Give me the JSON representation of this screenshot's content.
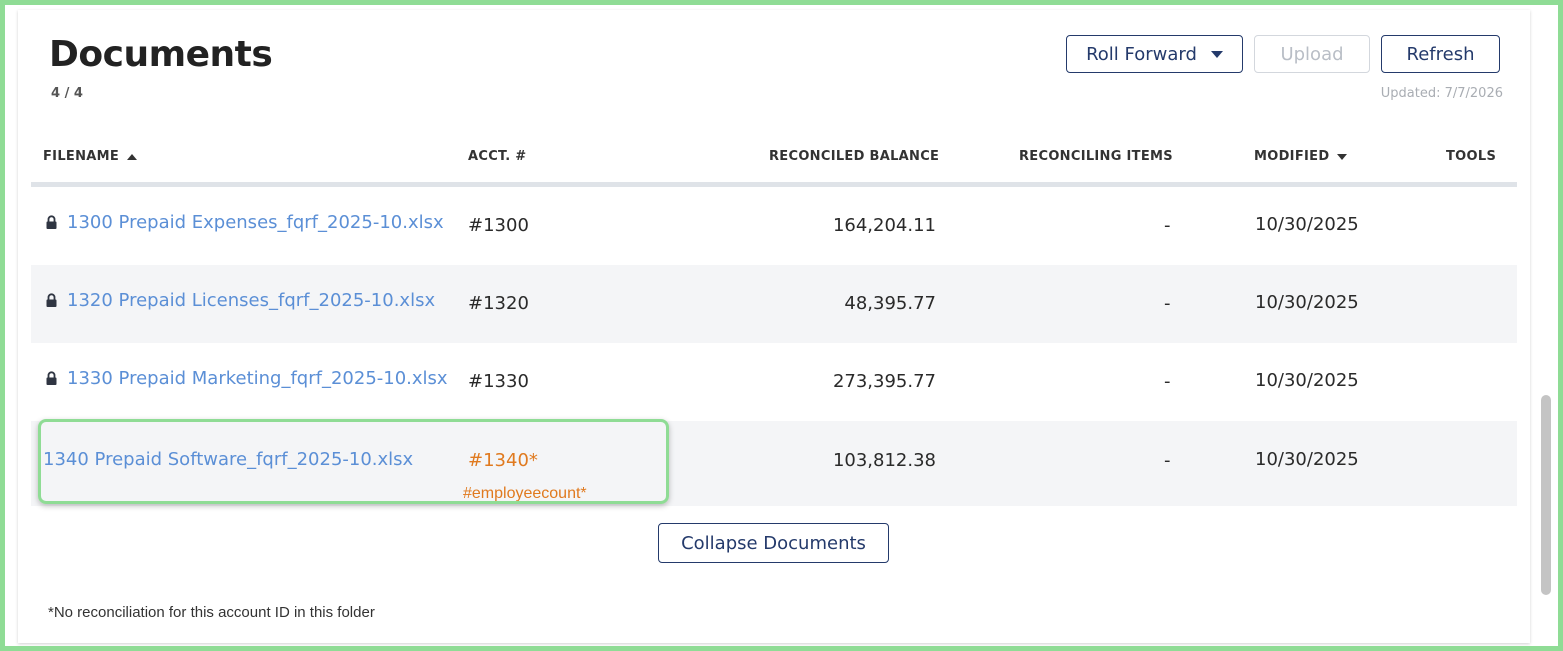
{
  "header": {
    "title": "Documents",
    "count": "4 / 4",
    "updated": "Updated: 7/7/2026"
  },
  "toolbar": {
    "roll_forward_label": "Roll Forward",
    "upload_label": "Upload",
    "refresh_label": "Refresh"
  },
  "table": {
    "columns": {
      "filename": "FILENAME",
      "acct": "ACCT. #",
      "balance": "RECONCILED BALANCE",
      "items": "RECONCILING ITEMS",
      "modified": "MODIFIED",
      "tools": "TOOLS"
    },
    "rows": [
      {
        "filename": "1300 Prepaid Expenses_fqrf_2025-10.xlsx",
        "acct": "#1300",
        "balance": "164,204.11",
        "items": "-",
        "modified": "10/30/2025",
        "locked": true
      },
      {
        "filename": "1320 Prepaid Licenses_fqrf_2025-10.xlsx",
        "acct": "#1320",
        "balance": "48,395.77",
        "items": "-",
        "modified": "10/30/2025",
        "locked": true
      },
      {
        "filename": "1330 Prepaid Marketing_fqrf_2025-10.xlsx",
        "acct": "#1330",
        "balance": "273,395.77",
        "items": "-",
        "modified": "10/30/2025",
        "locked": true
      },
      {
        "filename": "1340 Prepaid Software_fqrf_2025-10.xlsx",
        "acct": "#1340*",
        "acct_note": "#employeecount*",
        "balance": "103,812.38",
        "items": "-",
        "modified": "10/30/2025",
        "locked": false
      }
    ]
  },
  "collapse_label": "Collapse Documents",
  "footnote": "*No reconciliation for this account ID in this folder",
  "icons": {
    "lock": "lock-icon",
    "sort_asc": "sort-asc-icon",
    "sort_desc": "sort-desc-icon",
    "dropdown": "chevron-down-icon"
  },
  "colors": {
    "link": "#5b8fd6",
    "warning": "#e07a1f",
    "button_border": "#243a6b",
    "highlight": "#8fdc95"
  }
}
